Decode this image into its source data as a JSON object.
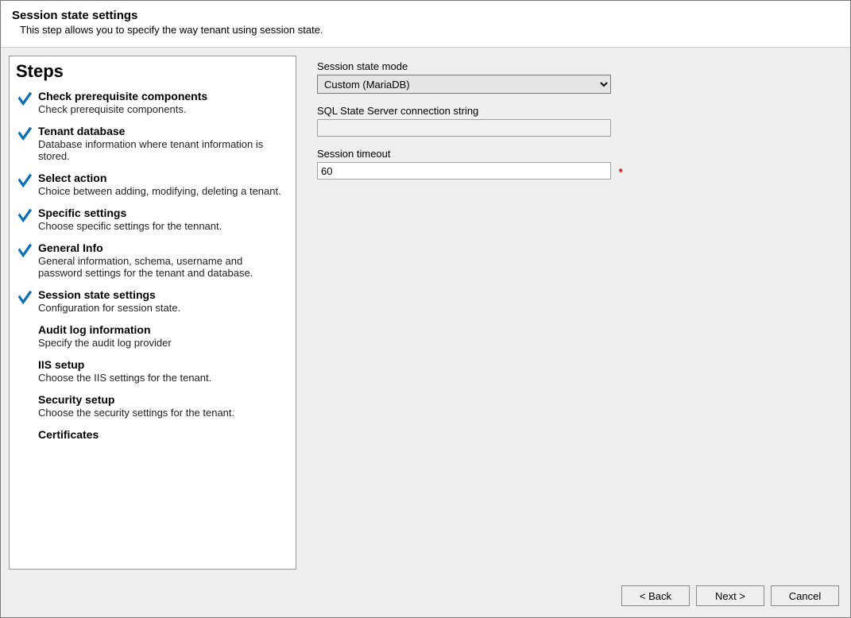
{
  "header": {
    "title": "Session state settings",
    "subtitle": "This step allows you to specify the way tenant using session state."
  },
  "steps_title": "Steps",
  "steps": [
    {
      "title": "Check prerequisite components",
      "desc": "Check prerequisite components.",
      "complete": true
    },
    {
      "title": "Tenant database",
      "desc": "Database information where tenant information is stored.",
      "complete": true
    },
    {
      "title": "Select action",
      "desc": "Choice between adding, modifying, deleting a tenant.",
      "complete": true
    },
    {
      "title": "Specific settings",
      "desc": "Choose specific settings for the tennant.",
      "complete": true
    },
    {
      "title": "General Info",
      "desc": "General information, schema, username and password settings for the tenant and database.",
      "complete": true
    },
    {
      "title": "Session state settings",
      "desc": "Configuration for session state.",
      "complete": true
    },
    {
      "title": "Audit log information",
      "desc": "Specify the audit log provider",
      "complete": false
    },
    {
      "title": "IIS setup",
      "desc": "Choose the IIS settings for the tenant.",
      "complete": false
    },
    {
      "title": "Security setup",
      "desc": "Choose the security settings for the tenant.",
      "complete": false
    },
    {
      "title": "Certificates",
      "desc": "",
      "complete": false
    }
  ],
  "form": {
    "mode_label": "Session state mode",
    "mode_value": "Custom (MariaDB)",
    "mode_options": [
      "Custom (MariaDB)"
    ],
    "conn_label": "SQL State Server connection string",
    "conn_value": "",
    "timeout_label": "Session timeout",
    "timeout_value": "60",
    "required_marker": "*"
  },
  "footer": {
    "back": "< Back",
    "next": "Next >",
    "cancel": "Cancel"
  }
}
